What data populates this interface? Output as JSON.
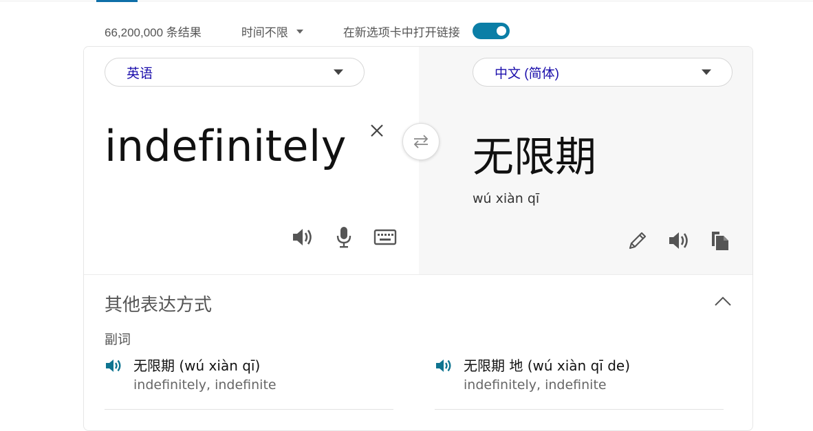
{
  "info_bar": {
    "result_count": "66,200,000 条结果",
    "time_filter": "时间不限",
    "open_new_tab_label": "在新选项卡中打开链接",
    "open_new_tab_enabled": true
  },
  "translator": {
    "source_language": "英语",
    "target_language": "中文 (简体)",
    "source_text": "indefinitely",
    "target_text": "无限期",
    "target_pinyin": "wú xiàn qī"
  },
  "other_expressions": {
    "title": "其他表达方式",
    "part_of_speech": "副词",
    "items": [
      {
        "term": "无限期 (wú xiàn qī)",
        "synonyms": "indefinitely, indefinite"
      },
      {
        "term": "无限期 地 (wú xiàn qī de)",
        "synonyms": "indefinitely, indefinite"
      }
    ]
  },
  "colors": {
    "accent": "#0b7ea6",
    "link_blue": "#1a0dab",
    "speaker_teal": "#0e7490"
  }
}
